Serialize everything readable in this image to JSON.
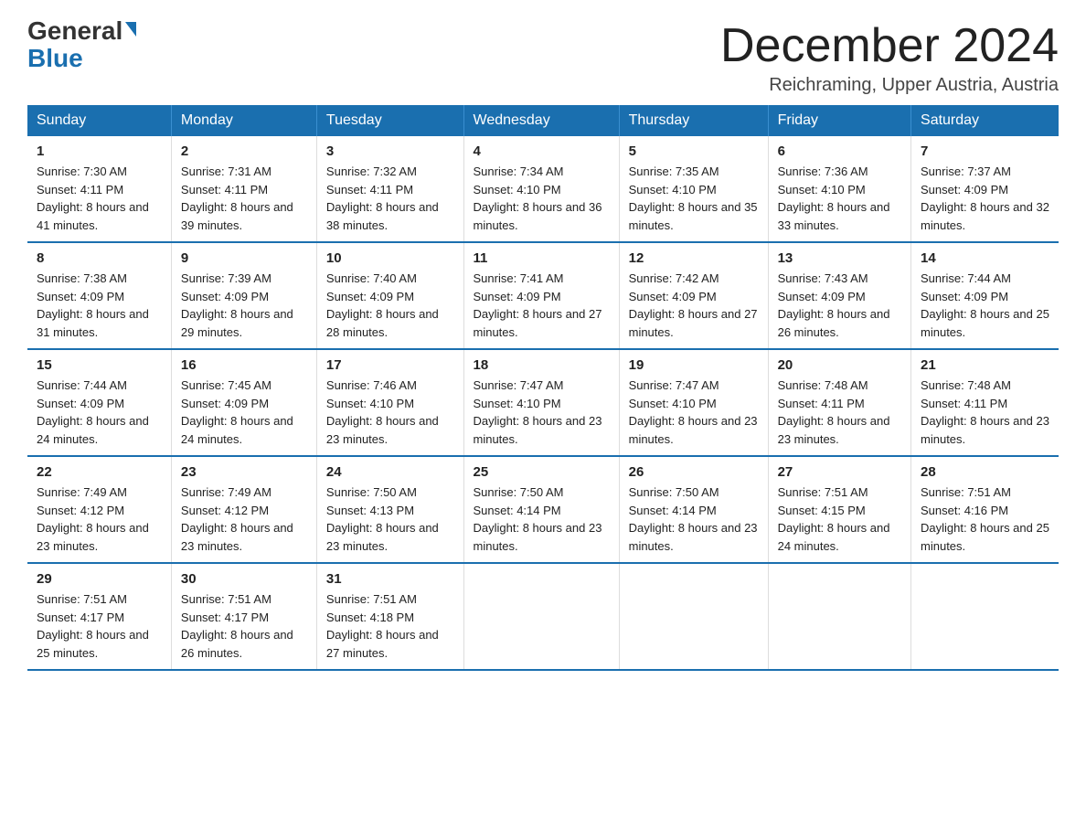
{
  "logo": {
    "line1": "General",
    "line2": "Blue"
  },
  "title": "December 2024",
  "location": "Reichraming, Upper Austria, Austria",
  "headers": [
    "Sunday",
    "Monday",
    "Tuesday",
    "Wednesday",
    "Thursday",
    "Friday",
    "Saturday"
  ],
  "weeks": [
    [
      {
        "day": "1",
        "sunrise": "7:30 AM",
        "sunset": "4:11 PM",
        "daylight": "8 hours and 41 minutes."
      },
      {
        "day": "2",
        "sunrise": "7:31 AM",
        "sunset": "4:11 PM",
        "daylight": "8 hours and 39 minutes."
      },
      {
        "day": "3",
        "sunrise": "7:32 AM",
        "sunset": "4:11 PM",
        "daylight": "8 hours and 38 minutes."
      },
      {
        "day": "4",
        "sunrise": "7:34 AM",
        "sunset": "4:10 PM",
        "daylight": "8 hours and 36 minutes."
      },
      {
        "day": "5",
        "sunrise": "7:35 AM",
        "sunset": "4:10 PM",
        "daylight": "8 hours and 35 minutes."
      },
      {
        "day": "6",
        "sunrise": "7:36 AM",
        "sunset": "4:10 PM",
        "daylight": "8 hours and 33 minutes."
      },
      {
        "day": "7",
        "sunrise": "7:37 AM",
        "sunset": "4:09 PM",
        "daylight": "8 hours and 32 minutes."
      }
    ],
    [
      {
        "day": "8",
        "sunrise": "7:38 AM",
        "sunset": "4:09 PM",
        "daylight": "8 hours and 31 minutes."
      },
      {
        "day": "9",
        "sunrise": "7:39 AM",
        "sunset": "4:09 PM",
        "daylight": "8 hours and 29 minutes."
      },
      {
        "day": "10",
        "sunrise": "7:40 AM",
        "sunset": "4:09 PM",
        "daylight": "8 hours and 28 minutes."
      },
      {
        "day": "11",
        "sunrise": "7:41 AM",
        "sunset": "4:09 PM",
        "daylight": "8 hours and 27 minutes."
      },
      {
        "day": "12",
        "sunrise": "7:42 AM",
        "sunset": "4:09 PM",
        "daylight": "8 hours and 27 minutes."
      },
      {
        "day": "13",
        "sunrise": "7:43 AM",
        "sunset": "4:09 PM",
        "daylight": "8 hours and 26 minutes."
      },
      {
        "day": "14",
        "sunrise": "7:44 AM",
        "sunset": "4:09 PM",
        "daylight": "8 hours and 25 minutes."
      }
    ],
    [
      {
        "day": "15",
        "sunrise": "7:44 AM",
        "sunset": "4:09 PM",
        "daylight": "8 hours and 24 minutes."
      },
      {
        "day": "16",
        "sunrise": "7:45 AM",
        "sunset": "4:09 PM",
        "daylight": "8 hours and 24 minutes."
      },
      {
        "day": "17",
        "sunrise": "7:46 AM",
        "sunset": "4:10 PM",
        "daylight": "8 hours and 23 minutes."
      },
      {
        "day": "18",
        "sunrise": "7:47 AM",
        "sunset": "4:10 PM",
        "daylight": "8 hours and 23 minutes."
      },
      {
        "day": "19",
        "sunrise": "7:47 AM",
        "sunset": "4:10 PM",
        "daylight": "8 hours and 23 minutes."
      },
      {
        "day": "20",
        "sunrise": "7:48 AM",
        "sunset": "4:11 PM",
        "daylight": "8 hours and 23 minutes."
      },
      {
        "day": "21",
        "sunrise": "7:48 AM",
        "sunset": "4:11 PM",
        "daylight": "8 hours and 23 minutes."
      }
    ],
    [
      {
        "day": "22",
        "sunrise": "7:49 AM",
        "sunset": "4:12 PM",
        "daylight": "8 hours and 23 minutes."
      },
      {
        "day": "23",
        "sunrise": "7:49 AM",
        "sunset": "4:12 PM",
        "daylight": "8 hours and 23 minutes."
      },
      {
        "day": "24",
        "sunrise": "7:50 AM",
        "sunset": "4:13 PM",
        "daylight": "8 hours and 23 minutes."
      },
      {
        "day": "25",
        "sunrise": "7:50 AM",
        "sunset": "4:14 PM",
        "daylight": "8 hours and 23 minutes."
      },
      {
        "day": "26",
        "sunrise": "7:50 AM",
        "sunset": "4:14 PM",
        "daylight": "8 hours and 23 minutes."
      },
      {
        "day": "27",
        "sunrise": "7:51 AM",
        "sunset": "4:15 PM",
        "daylight": "8 hours and 24 minutes."
      },
      {
        "day": "28",
        "sunrise": "7:51 AM",
        "sunset": "4:16 PM",
        "daylight": "8 hours and 25 minutes."
      }
    ],
    [
      {
        "day": "29",
        "sunrise": "7:51 AM",
        "sunset": "4:17 PM",
        "daylight": "8 hours and 25 minutes."
      },
      {
        "day": "30",
        "sunrise": "7:51 AM",
        "sunset": "4:17 PM",
        "daylight": "8 hours and 26 minutes."
      },
      {
        "day": "31",
        "sunrise": "7:51 AM",
        "sunset": "4:18 PM",
        "daylight": "8 hours and 27 minutes."
      },
      {
        "day": "",
        "sunrise": "",
        "sunset": "",
        "daylight": ""
      },
      {
        "day": "",
        "sunrise": "",
        "sunset": "",
        "daylight": ""
      },
      {
        "day": "",
        "sunrise": "",
        "sunset": "",
        "daylight": ""
      },
      {
        "day": "",
        "sunrise": "",
        "sunset": "",
        "daylight": ""
      }
    ]
  ]
}
